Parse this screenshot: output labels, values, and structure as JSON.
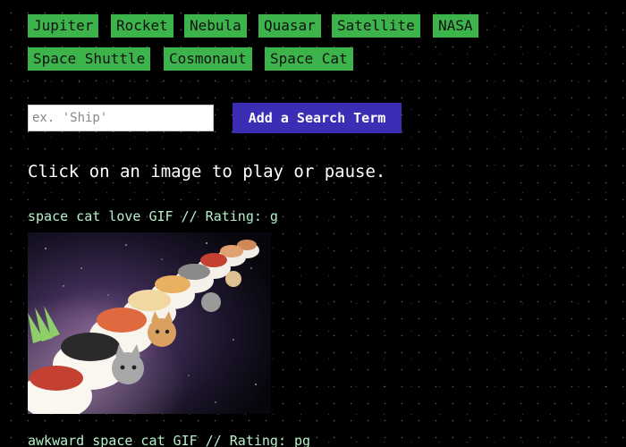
{
  "search_terms": [
    "Jupiter",
    "Rocket",
    "Nebula",
    "Quasar",
    "Satellite",
    "NASA",
    "Space Shuttle",
    "Cosmonaut",
    "Space Cat"
  ],
  "search": {
    "placeholder": "ex. 'Ship'",
    "value": "",
    "add_button_label": "Add a Search Term"
  },
  "instructions": "Click on an image to play or pause.",
  "gifs": [
    {
      "caption": "space cat love GIF // Rating: g",
      "image": "cats riding sushi rolls through space"
    },
    {
      "caption": "awkward space cat GIF // Rating: pg"
    }
  ],
  "colors": {
    "tag_button": "#3cb44b",
    "add_button": "#3b2db4",
    "caption": "#b5f0c8",
    "background": "#000000"
  }
}
